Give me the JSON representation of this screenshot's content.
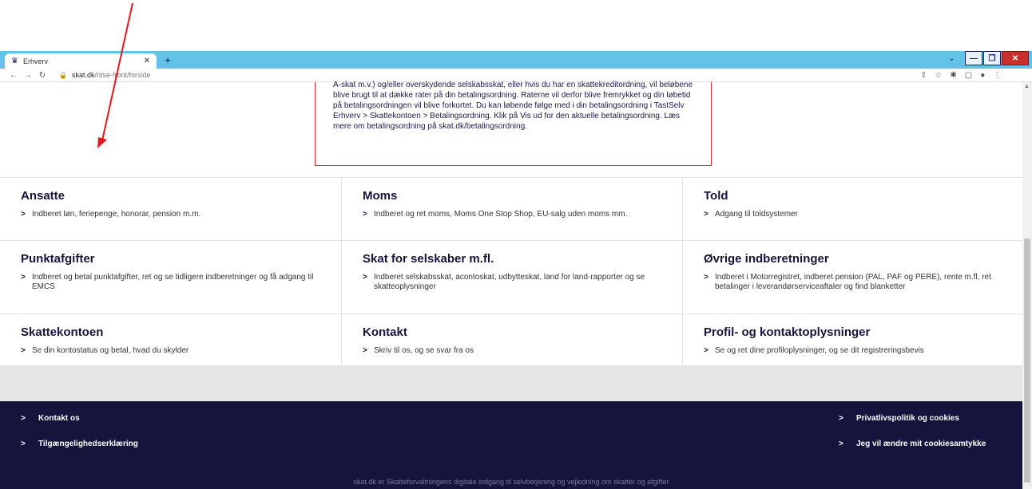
{
  "browser": {
    "tab_title": "Erhverv",
    "url_host": "skat.dk",
    "url_path": "/ntse-front/forside"
  },
  "notice": {
    "text": "A-skat m.v.) og/eller overskydende selskabsskat, eller hvis du har en skattekreditordning, vil beløbene blive brugt til at dække rater på din betalingsordning. Raterne vil derfor blive fremrykket og din løbetid på betalingsordningen vil blive forkortet. Du kan løbende følge med i din betalingsordning i TastSelv Erhverv > Skattekontoen > Betalingsordning. Klik på Vis ud for den aktuelle betalingsordning. Læs mere om betalingsordning på skat.dk/betalingsordning."
  },
  "sections": [
    {
      "title": "Ansatte",
      "link": "Indberet løn, feriepenge, honorar, pension m.m."
    },
    {
      "title": "Moms",
      "link": "Indberet og ret moms, Moms One Stop Shop, EU-salg uden moms mm."
    },
    {
      "title": "Told",
      "link": "Adgang til toldsystemer"
    },
    {
      "title": "Punktafgifter",
      "link": "Indberet og betal punktafgifter, ret og se tidligere indberetninger og få adgang til EMCS"
    },
    {
      "title": "Skat for selskaber m.fl.",
      "link": "Indberet selskabsskat, acontoskat, udbytteskat, land for land-rapporter og se skatteoplysninger"
    },
    {
      "title": "Øvrige indberetninger",
      "link": "Indberet i Motorregistret, indberet pension (PAL, PAF og PERE), rente m.fl, ret betalinger i leverandørserviceaftaler og find blanketter"
    },
    {
      "title": "Skattekontoen",
      "link": "Se din kontostatus og betal, hvad du skylder"
    },
    {
      "title": "Kontakt",
      "link": "Skriv til os, og se svar fra os"
    },
    {
      "title": "Profil- og kontaktoplysninger",
      "link": "Se og ret dine profiloplysninger, og se dit registreringsbevis"
    }
  ],
  "footer": {
    "links_left": [
      "Kontakt os",
      "Tilgængelighedserklæring"
    ],
    "links_right": [
      "Privatlivspolitik og cookies",
      "Jeg vil ændre mit cookiesamtykke"
    ],
    "description": "skat.dk er Skatteforvaltningens digitale indgang til selvbetjening og vejledning om skatter og afgifter"
  },
  "colors": {
    "tabbar": "#62c3e6",
    "footer": "#14143c",
    "notice_border": "#d9303a",
    "annotation_arrow": "#e0191e"
  },
  "icons": {
    "tab_favicon": "crown-icon",
    "link_chevron": "chevron-right-icon"
  }
}
